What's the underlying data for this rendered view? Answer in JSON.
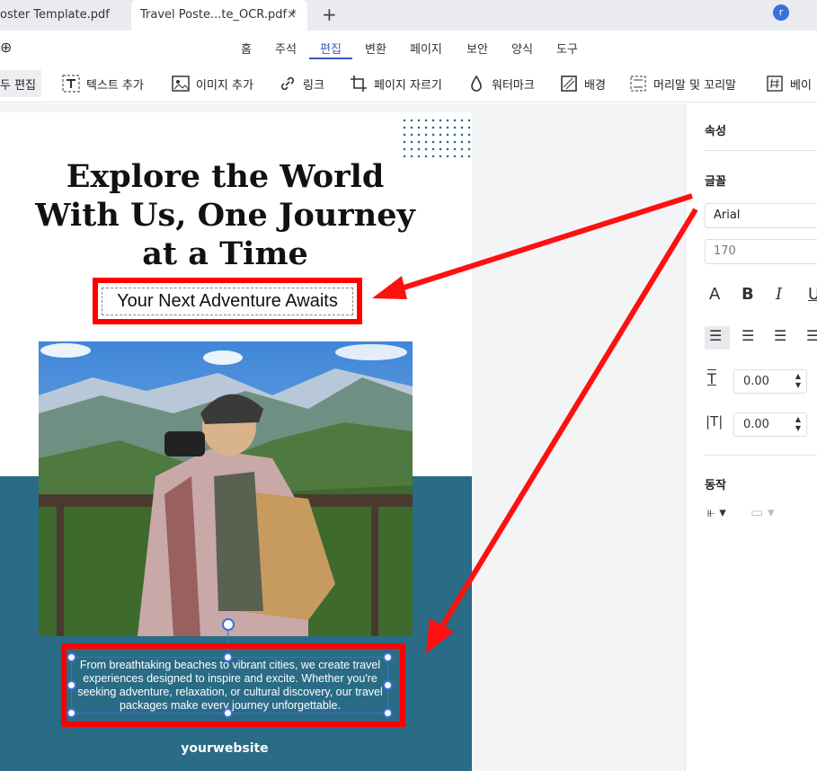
{
  "tabs": [
    {
      "label": "oster Template.pdf"
    },
    {
      "label": "Travel Poste...te_OCR.pdf *"
    }
  ],
  "tab_close": "×",
  "new_tab": "+",
  "avatar_letter": "r",
  "menu": [
    "홈",
    "주석",
    "편집",
    "변환",
    "페이지",
    "보안",
    "양식",
    "도구"
  ],
  "menu_active": "편집",
  "toolbar": [
    {
      "label": "두 편집",
      "icon": "edit-all-icon"
    },
    {
      "label": "텍스트 추가",
      "icon": "add-text-icon"
    },
    {
      "label": "이미지 추가",
      "icon": "add-image-icon"
    },
    {
      "label": "링크",
      "icon": "link-icon"
    },
    {
      "label": "페이지 자르기",
      "icon": "crop-icon"
    },
    {
      "label": "워터마크",
      "icon": "watermark-icon"
    },
    {
      "label": "배경",
      "icon": "background-icon"
    },
    {
      "label": "머리말 및 꼬리말",
      "icon": "header-footer-icon"
    },
    {
      "label": "베이",
      "icon": "bates-icon"
    }
  ],
  "document": {
    "title": "Explore the World With Us, One Journey at a Time",
    "subtitle": "Your Next Adventure Awaits",
    "body": "From breathtaking beaches to vibrant cities, we create travel experiences designed to inspire and excite. Whether you're seeking adventure, relaxation, or cultural discovery, our travel packages make every journey unforgettable.",
    "website": "yourwebsite"
  },
  "panel": {
    "properties_label": "속성",
    "font_label": "글꼴",
    "font_value": "Arial",
    "font_size": "170",
    "char_spacing": "0.00",
    "line_spacing": "0.00",
    "action_label": "동작"
  },
  "colors": {
    "accent": "#3f59c6",
    "highlight": "#ff0000",
    "poster_teal": "#2a6b85"
  }
}
